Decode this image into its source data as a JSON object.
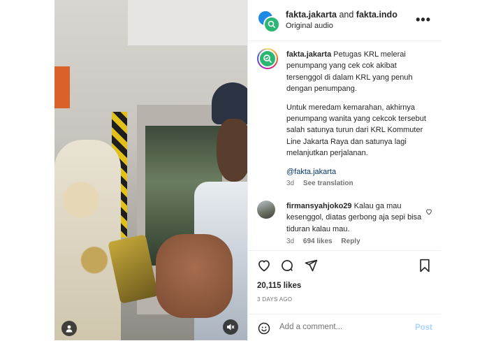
{
  "header": {
    "user1": "fakta.jakarta",
    "conjunction": "and",
    "user2": "fakta.indo",
    "audio": "Original audio"
  },
  "caption": {
    "username": "fakta.jakarta",
    "paragraph1": "Petugas KRL melerai penumpang yang cek cok akibat tersenggol di dalam KRL yang penuh dengan penumpang.",
    "paragraph2": "Untuk meredam kemarahan, akhirnya penumpang wanita yang cekcok tersebut salah satunya turun dari KRL Kommuter Line Jakarta Raya dan satunya lagi melanjutkan perjalanan.",
    "mention": "@fakta.jakarta",
    "time": "3d",
    "see_translation": "See translation"
  },
  "comment": {
    "username": "firmansyahjoko29",
    "text": "Kalau ga mau kesenggol, diatas gerbong aja sepi bisa tiduran kalau mau.",
    "time": "3d",
    "likes": "694 likes",
    "reply": "Reply"
  },
  "stats": {
    "likes": "20,115 likes",
    "date": "3 DAYS AGO"
  },
  "add_comment": {
    "placeholder": "Add a comment...",
    "post_label": "Post"
  },
  "colors": {
    "link": "#00376b",
    "muted": "#737373",
    "post_button": "#a8d5ff",
    "avatar_green": "#2bb673",
    "avatar_blue": "#1e88e5"
  }
}
